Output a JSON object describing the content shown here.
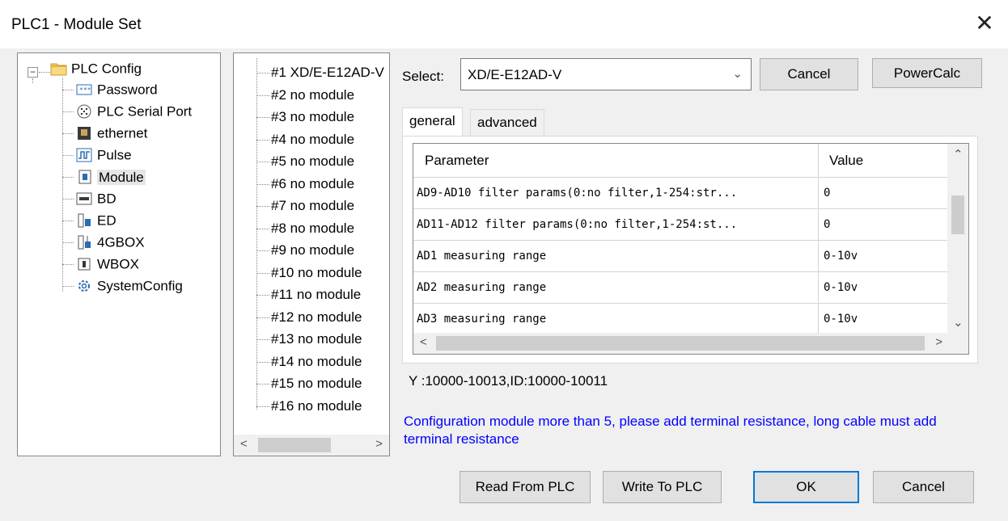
{
  "window": {
    "title": "PLC1 - Module Set",
    "close_glyph": "✕"
  },
  "tree": {
    "root": {
      "label": "PLC Config",
      "icon": "folder-icon",
      "expander": "−"
    },
    "items": [
      {
        "label": "Password",
        "icon": "password-icon"
      },
      {
        "label": "PLC Serial Port",
        "icon": "serial-port-icon"
      },
      {
        "label": "ethernet",
        "icon": "ethernet-icon"
      },
      {
        "label": "Pulse",
        "icon": "pulse-icon"
      },
      {
        "label": "Module",
        "icon": "module-icon"
      },
      {
        "label": "BD",
        "icon": "bd-icon"
      },
      {
        "label": "ED",
        "icon": "ed-icon"
      },
      {
        "label": "4GBOX",
        "icon": "4gbox-icon"
      },
      {
        "label": "WBOX",
        "icon": "wbox-icon"
      },
      {
        "label": "SystemConfig",
        "icon": "gear-icon"
      }
    ],
    "selected": "Module"
  },
  "modules": [
    "#1 XD/E-E12AD-V",
    "#2 no module",
    "#3 no module",
    "#4 no module",
    "#5 no module",
    "#6 no module",
    "#7 no module",
    "#8 no module",
    "#9 no module",
    "#10 no module",
    "#11 no module",
    "#12 no module",
    "#13 no module",
    "#14 no module",
    "#15 no module",
    "#16 no module"
  ],
  "select": {
    "label": "Select:",
    "value": "XD/E-E12AD-V"
  },
  "buttons": {
    "cancel_top": "Cancel",
    "power_calc": "PowerCalc",
    "read_from_plc": "Read From PLC",
    "write_to_plc": "Write To PLC",
    "ok": "OK",
    "cancel_bottom": "Cancel"
  },
  "tabs": [
    {
      "label": "general",
      "active": true
    },
    {
      "label": "advanced",
      "active": false
    }
  ],
  "grid": {
    "headers": {
      "parameter": "Parameter",
      "value": "Value"
    },
    "rows": [
      {
        "parameter": "AD9-AD10 filter params(0:no filter,1-254:str...",
        "value": "0"
      },
      {
        "parameter": "AD11-AD12 filter params(0:no filter,1-254:st...",
        "value": "0"
      },
      {
        "parameter": "AD1 measuring range",
        "value": "0-10v"
      },
      {
        "parameter": "AD2 measuring range",
        "value": "0-10v"
      },
      {
        "parameter": "AD3 measuring range",
        "value": "0-10v"
      }
    ]
  },
  "info_text": "Y :10000-10013,ID:10000-10011",
  "note_text": "Configuration module more than 5, please add terminal resistance, long cable must add terminal resistance",
  "colors": {
    "note": "#0000ff",
    "primary_border": "#0078d7"
  }
}
